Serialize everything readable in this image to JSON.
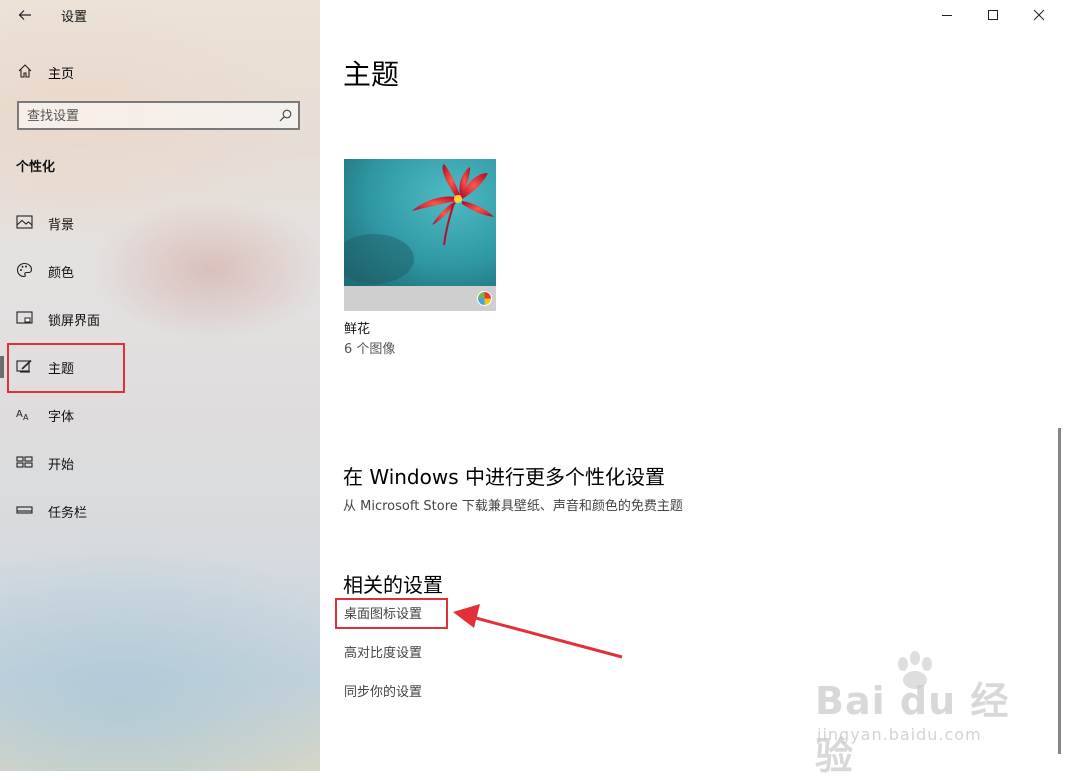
{
  "window": {
    "title": "设置",
    "controls": [
      "minimize-icon",
      "maximize-icon",
      "close-icon"
    ]
  },
  "sidebar": {
    "home_label": "主页",
    "search": {
      "placeholder": "查找设置",
      "value": ""
    },
    "section_header": "个性化",
    "items": [
      {
        "label": "背景",
        "icon": "picture-icon"
      },
      {
        "label": "颜色",
        "icon": "palette-icon"
      },
      {
        "label": "锁屏界面",
        "icon": "lockscreen-icon"
      },
      {
        "label": "主题",
        "icon": "theme-brush-icon",
        "selected": true
      },
      {
        "label": "字体",
        "icon": "font-icon"
      },
      {
        "label": "开始",
        "icon": "start-icon"
      },
      {
        "label": "任务栏",
        "icon": "taskbar-icon"
      }
    ]
  },
  "main": {
    "page_title": "主题",
    "theme": {
      "name": "鲜花",
      "count": "6 个图像"
    },
    "more": {
      "title": "在 Windows 中进行更多个性化设置",
      "subtitle": "从 Microsoft Store 下载兼具壁纸、声音和颜色的免费主题"
    },
    "related": {
      "title": "相关的设置",
      "links": [
        "桌面图标设置",
        "高对比度设置",
        "同步你的设置"
      ]
    }
  },
  "annotation_color": "#e0313a",
  "watermark": {
    "brand": "Bai du 经验",
    "url": "jingyan.baidu.com"
  }
}
